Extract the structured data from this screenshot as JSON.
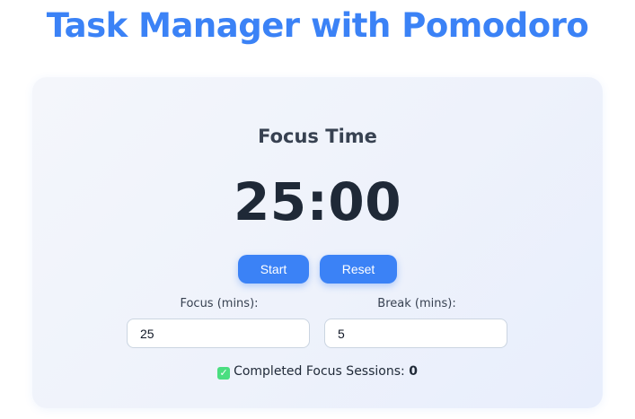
{
  "header": {
    "title": "Task Manager with Pomodoro"
  },
  "pomodoro": {
    "mode_label": "Focus Time",
    "timer": "25:00",
    "start_label": "Start",
    "reset_label": "Reset",
    "focus_label": "Focus (mins):",
    "focus_value": "25",
    "break_label": "Break (mins):",
    "break_value": "5",
    "sessions_label": "Completed Focus Sessions:",
    "sessions_count": "0",
    "sessions_icon": "check-box-icon"
  },
  "colors": {
    "accent": "#3b82f6",
    "title": "#3b82f6",
    "text_dark": "#1f2937",
    "check_green": "#4ade80"
  }
}
